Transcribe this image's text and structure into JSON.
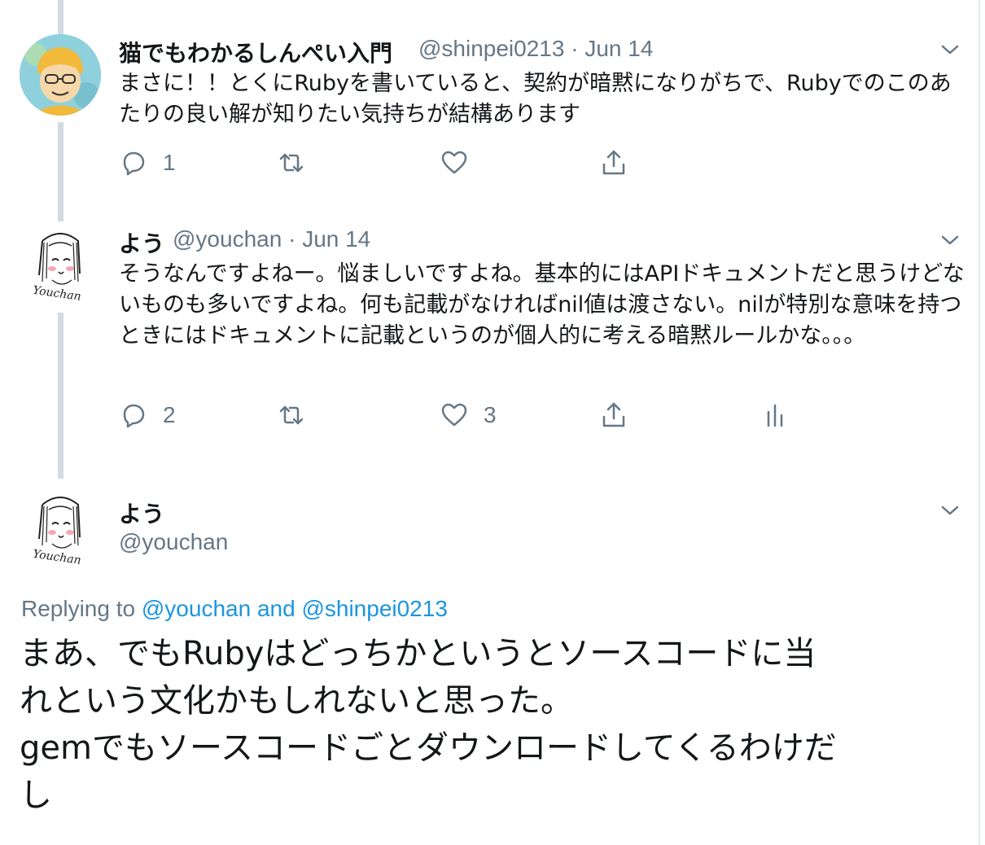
{
  "tweet1": {
    "name": "猫でもわかるしんぺい入門",
    "handle": "@shinpei0213",
    "separator": "·",
    "date": "Jun 14",
    "text": "まさに！！とくにRubyを書いていると、契約が暗黙になりがちで、Rubyでのこのあたりの良い解が知りたい気持ちが結構あります",
    "reply_count": "1",
    "avatar_icon": "avatar-illustration"
  },
  "tweet2": {
    "name": "よう",
    "handle": "@youchan",
    "separator": "·",
    "date": "Jun 14",
    "text": "そうなんですよねー。悩ましいですよね。基本的にはAPIドキュメントだと思うけどないものも多いですよね。何も記載がなければnil値は渡さない。nilが特別な意味を持つときにはドキュメントに記載というのが個人的に考える暗黙ルールかな。。。",
    "reply_count": "2",
    "like_count": "3",
    "avatar_signature": "Youchan"
  },
  "main_tweet": {
    "name": "よう",
    "handle": "@youchan",
    "replying_prefix": "Replying to",
    "replying_user1": "@youchan",
    "replying_and": "and",
    "replying_user2": "@shinpei0213",
    "text_line1": "まあ、でもRubyはどっちかというとソースコードに当",
    "text_line2": "れという文化かもしれないと思った。",
    "text_line3": "gemでもソースコードごとダウンロードしてくるわけだ",
    "text_line4": "し",
    "avatar_signature": "Youchan"
  },
  "colors": {
    "text": "#14171a",
    "muted": "#657786",
    "link": "#1b95e0",
    "thread_line": "#d3dbe2"
  }
}
